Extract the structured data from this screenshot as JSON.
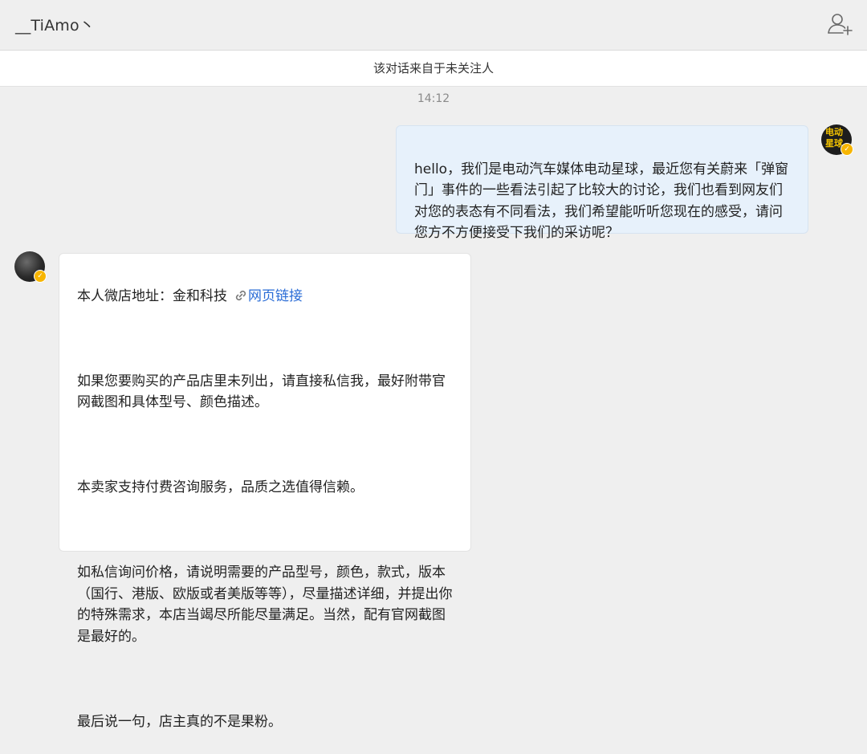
{
  "header": {
    "title": "__TiAmo丶",
    "add_friend_icon": "add-user-icon"
  },
  "notice": {
    "text": "该对话来自于未关注人"
  },
  "timestamp": "14:12",
  "messages": {
    "outgoing": {
      "avatar_text_line1": "电动",
      "avatar_text_line2": "星球",
      "text": "hello，我们是电动汽车媒体电动星球，最近您有关蔚来「弹窗门」事件的一些看法引起了比较大的讨论，我们也看到网友们对您的表态有不同看法，我们希望能听听您现在的感受，请问您方不方便接受下我们的采访呢？"
    },
    "incoming": {
      "shop_prefix": "本人微店地址：金和科技",
      "link_icon": "link-icon",
      "link_label": "网页链接",
      "paragraph1": "如果您要购买的产品店里未列出，请直接私信我，最好附带官网截图和具体型号、颜色描述。",
      "paragraph2": "本卖家支持付费咨询服务，品质之选值得信赖。",
      "paragraph3": "如私信询问价格，请说明需要的产品型号，颜色，款式，版本（国行、港版、欧版或者美版等等），尽量描述详细，并提出你的特殊需求，本店当竭尽所能尽量满足。当然，配有官网截图是最好的。",
      "paragraph4": "最后说一句，店主真的不是果粉。"
    }
  },
  "colors": {
    "background": "#efefef",
    "outgoing_bubble": "#e7f1fb",
    "incoming_bubble": "#ffffff",
    "link": "#2a6cd6",
    "verified_badge": "#f7b500"
  }
}
